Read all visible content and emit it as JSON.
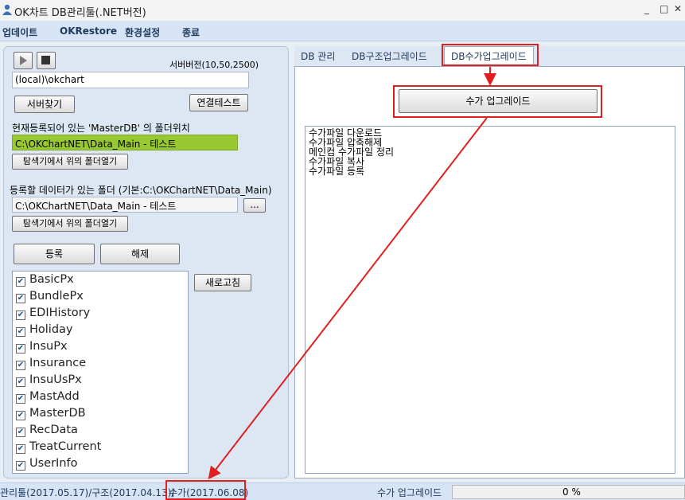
{
  "window": {
    "title": "OK차트 DB관리툴(.NET버전)",
    "minimize": "_",
    "maximize": "□",
    "close": "✕"
  },
  "menu": [
    "업데이트",
    "OKRestore",
    "환경설정",
    "종료"
  ],
  "left": {
    "server_version": "서버버전(10,50,2500)",
    "server_input": "(local)\\okchart",
    "find_server": "서버찾기",
    "test_connection": "연결테스트",
    "registered_label": "현재등록되어 있는 'MasterDB' 의 폴더위치",
    "registered_path": "C:\\OKChartNET\\Data_Main - 테스트",
    "open_folder_1": "탐색기에서 위의 폴더열기",
    "data_folder_label": "등록할 데이터가 있는 폴더 (기본:C:\\OKChartNET\\Data_Main)",
    "data_folder_path": "C:\\OKChartNET\\Data_Main - 테스트",
    "browse": "...",
    "open_folder_2": "탐색기에서 위의 폴더열기",
    "register": "등록",
    "unregister": "해제",
    "refresh": "새로고침",
    "databases": [
      "BasicPx",
      "BundlePx",
      "EDIHistory",
      "Holiday",
      "InsuPx",
      "Insurance",
      "InsuUsPx",
      "MastAdd",
      "MasterDB",
      "RecData",
      "TreatCurrent",
      "UserInfo"
    ]
  },
  "tabs": [
    "DB 관리",
    "DB구조업그레이드",
    "DB수가업그레이드"
  ],
  "right": {
    "upgrade_button": "수가 업그레이드",
    "log_lines": [
      "수가파일 다운로드",
      "수가파일 압축해제",
      "메인컴 수가파일 정리",
      "수가파일 복사",
      "수가파일 등록"
    ]
  },
  "status": {
    "version_text": "관리툴(2017.05.17)/구조(2017.04.13)/",
    "price_version": "수가(2017.06.08)",
    "task": "수가 업그레이드",
    "progress": "0 %"
  },
  "colors": {
    "highlight_green": "#99c930",
    "annotation_red": "#e02020"
  }
}
